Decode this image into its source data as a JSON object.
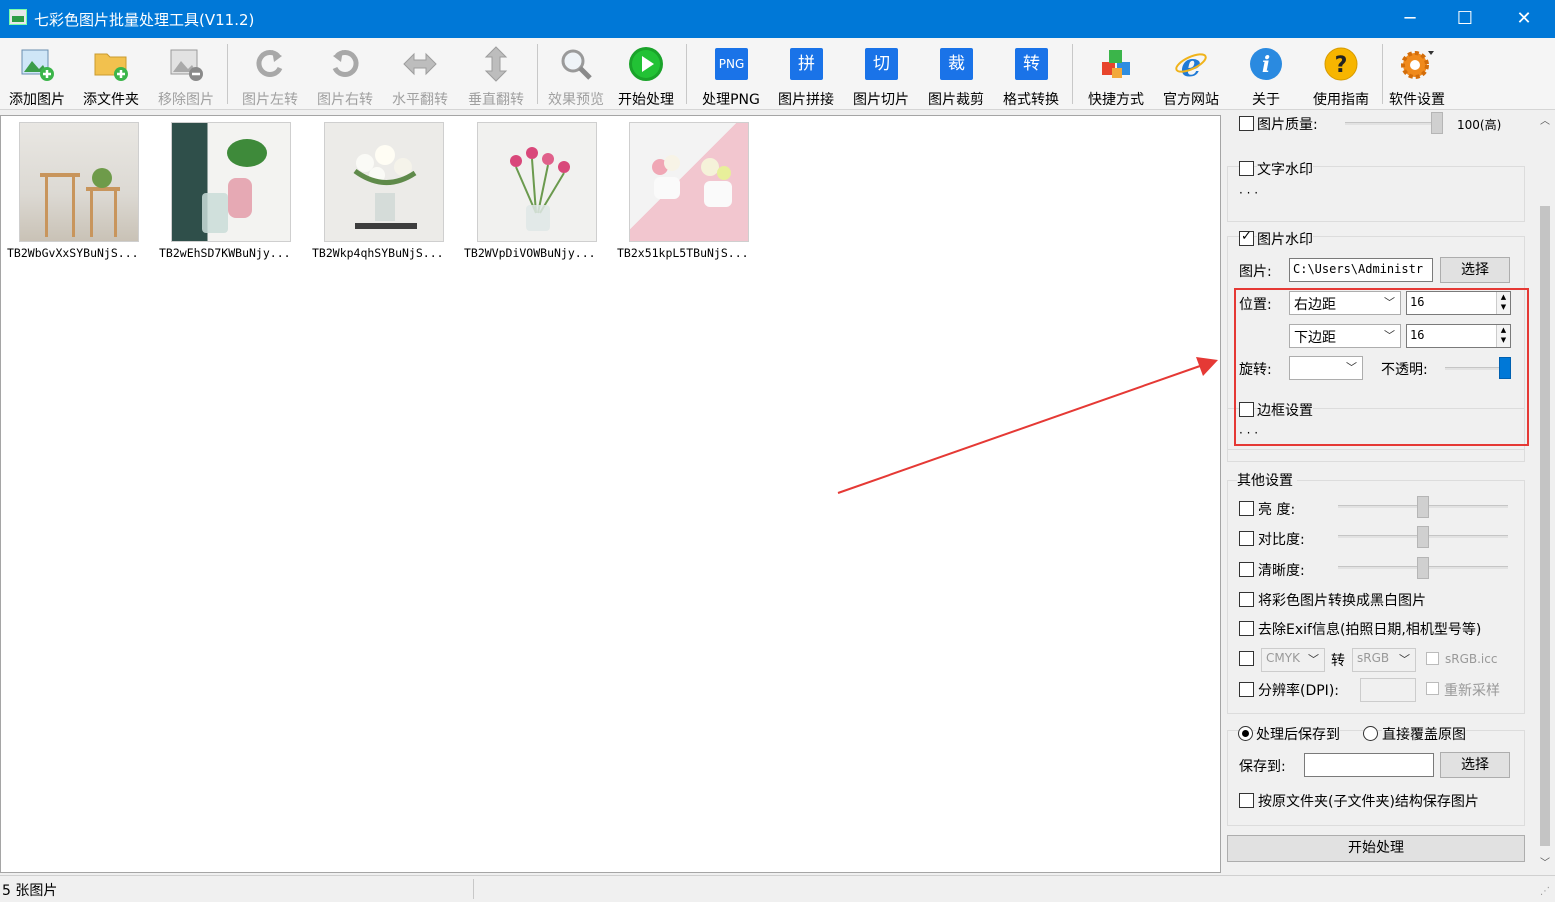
{
  "window": {
    "title": "七彩色图片批量处理工具(V11.2)",
    "controls": {
      "minimize": "─",
      "maximize": "☐",
      "close": "✕"
    }
  },
  "toolbar": {
    "add_image": "添加图片",
    "add_folder": "添文件夹",
    "remove_image": "移除图片",
    "rotate_left": "图片左转",
    "rotate_right": "图片右转",
    "flip_horizontal": "水平翻转",
    "flip_vertical": "垂直翻转",
    "preview": "效果预览",
    "start": "开始处理",
    "process_png": "处理PNG",
    "png_badge": "PNG",
    "stitch": "图片拼接",
    "stitch_icon": "拼",
    "slice": "图片切片",
    "slice_icon": "切",
    "crop": "图片裁剪",
    "crop_icon": "裁",
    "convert": "格式转换",
    "convert_icon": "转",
    "shortcut": "快捷方式",
    "website": "官方网站",
    "about": "关于",
    "guide": "使用指南",
    "settings": "软件设置"
  },
  "images": [
    {
      "name": "TB2WbGvXxSYBuNjS..."
    },
    {
      "name": "TB2wEhSD7KWBuNjy..."
    },
    {
      "name": "TB2Wkp4qhSYBuNjS..."
    },
    {
      "name": "TB2WVpDiVOWBuNjy..."
    },
    {
      "name": "TB2x51kpL5TBuNjS..."
    }
  ],
  "panel": {
    "quality": {
      "label": "图片质量:",
      "value": "100(高)",
      "level": 1.0
    },
    "text_watermark": {
      "label": "文字水印",
      "dots": "· · ·",
      "checked": false
    },
    "image_watermark": {
      "label": "图片水印",
      "checked": true,
      "image_label": "图片:",
      "image_path": "C:\\Users\\Administr",
      "choose": "选择",
      "position_label": "位置:",
      "h_anchor": "右边距",
      "h_value": "16",
      "v_anchor": "下边距",
      "v_value": "16",
      "rotate_label": "旋转:",
      "rotate_value": "",
      "opacity_label": "不透明:",
      "opacity_level": 1.0
    },
    "border": {
      "label": "边框设置",
      "dots": "· · ·",
      "checked": false
    },
    "other": {
      "title": "其他设置",
      "brightness": "亮  度:",
      "contrast": "对比度:",
      "sharpness": "清晰度:",
      "grayscale": "将彩色图片转换成黑白图片",
      "remove_exif": "去除Exif信息(拍照日期,相机型号等)",
      "cmyk": "CMYK",
      "to": "转",
      "srgb": "sRGB",
      "srgb_icc": "sRGB.icc",
      "dpi": "分辨率(DPI):",
      "resample": "重新采样"
    },
    "save": {
      "save_to_option": "处理后保存到",
      "overwrite_option": "直接覆盖原图",
      "save_to_label": "保存到:",
      "save_path": "",
      "choose": "选择",
      "keep_structure": "按原文件夹(子文件夹)结构保存图片"
    },
    "start_button": "开始处理"
  },
  "status": {
    "count": "5 张图片"
  },
  "colors": {
    "accent": "#0078d7",
    "annotation": "#e53935"
  }
}
